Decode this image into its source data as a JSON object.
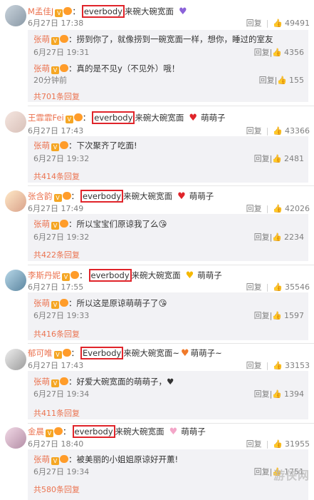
{
  "ui": {
    "reply_label": "回复",
    "separator": "|"
  },
  "posts": [
    {
      "user": "M孟佳J",
      "prefix": "：",
      "boxed": "everbody",
      "text": "来碗大碗宽面",
      "heart_color": "#8b62d9",
      "tail": "",
      "date": "6月27日 17:38",
      "likes": "49491",
      "replies": [
        {
          "user": "张萌",
          "text": "：捞到你了，就像捞到一碗宽面一样，想你，睡过的室友",
          "date": "6月27日 19:31",
          "likes": "4356"
        },
        {
          "user": "张萌",
          "text": "：真的是不见y（不见外）哦！",
          "date": "20分钟前",
          "likes": "155"
        }
      ],
      "more": "共701条回复"
    },
    {
      "user": "王霏霏Fei",
      "prefix": "：",
      "boxed": "everbody",
      "text": "来碗大碗宽面",
      "heart_color": "#e0242a",
      "tail": "萌萌子",
      "date": "6月27日 17:43",
      "likes": "43366",
      "replies": [
        {
          "user": "张萌",
          "text": "：下次聚齐了吃面!",
          "date": "6月27日 19:32",
          "likes": "2481"
        }
      ],
      "more": "共414条回复"
    },
    {
      "user": "张含韵",
      "prefix": "：",
      "boxed": "everbody",
      "text": "来碗大碗宽面",
      "heart_color": "#e0242a",
      "tail": "萌萌子",
      "date": "6月27日 17:49",
      "likes": "42026",
      "replies": [
        {
          "user": "张萌",
          "text": "：所以宝宝们原谅我了么😘",
          "date": "6月27日 19:32",
          "likes": "2234"
        }
      ],
      "more": "共422条回复"
    },
    {
      "user": "李斯丹妮",
      "prefix": "：",
      "boxed": "everbody",
      "text": "来碗大碗宽面",
      "heart_color": "#f5b800",
      "tail": "萌萌子",
      "date": "6月27日 17:55",
      "likes": "35546",
      "replies": [
        {
          "user": "张萌",
          "text": "：所以这是原谅萌萌子了😘",
          "date": "6月27日 19:33",
          "likes": "1597"
        }
      ],
      "more": "共416条回复"
    },
    {
      "user": "郁可唯",
      "prefix": "：",
      "boxed": "Everbody",
      "text": "来碗大碗宽面~",
      "heart_color": "#f07a2a",
      "tail": "萌萌子~",
      "date": "6月27日 17:43",
      "likes": "33153",
      "replies": [
        {
          "user": "张萌",
          "text": "：好爱大碗宽面的萌萌子，♥",
          "date": "6月27日 19:34",
          "likes": "1394"
        }
      ],
      "more": "共411条回复"
    },
    {
      "user": "金晨",
      "prefix": "：",
      "boxed": "everbody",
      "text": "来碗大碗宽面",
      "heart_color": "#f3a6c8",
      "tail": "萌萌子",
      "date": "6月27日 18:40",
      "likes": "31955",
      "replies": [
        {
          "user": "张萌",
          "text": "：被美丽的小姐姐原谅好开薰!",
          "date": "6月27日 19:34",
          "likes": "1751"
        }
      ],
      "more": "共580条回复"
    }
  ],
  "watermark": "游侠网"
}
